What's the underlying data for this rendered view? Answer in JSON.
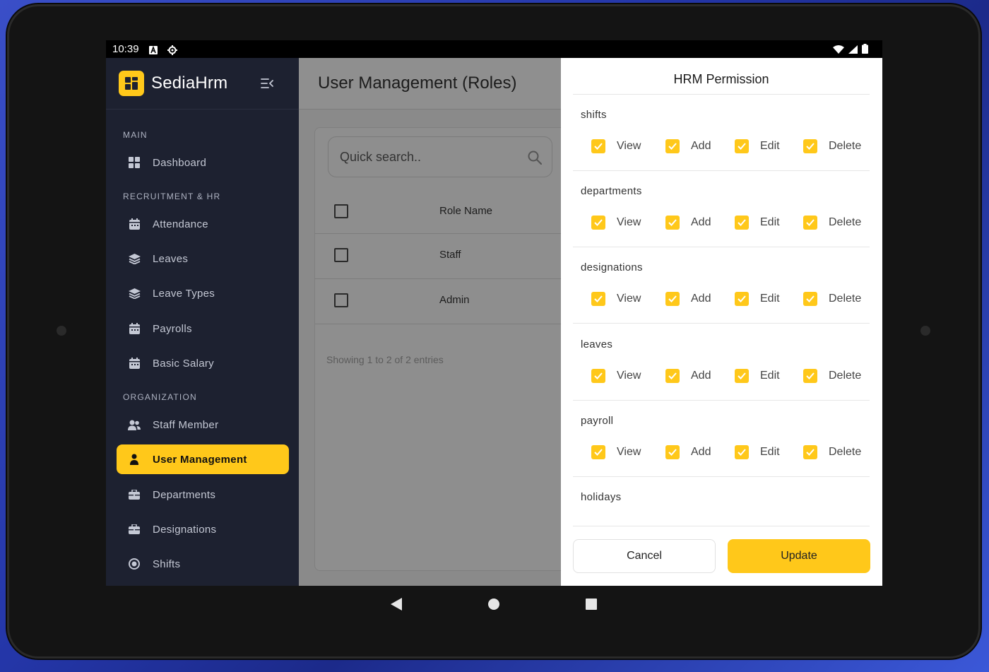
{
  "status_bar": {
    "time": "10:39"
  },
  "sidebar": {
    "brand": "SediaHrm",
    "sections": {
      "main": "MAIN",
      "recruitment": "RECRUITMENT & HR",
      "organization": "ORGANIZATION"
    },
    "items": {
      "dashboard": {
        "label": "Dashboard",
        "icon": "dashboard-icon"
      },
      "attendance": {
        "label": "Attendance",
        "icon": "calendar-icon"
      },
      "leaves": {
        "label": "Leaves",
        "icon": "layers-icon"
      },
      "leave_types": {
        "label": "Leave Types",
        "icon": "layers-icon"
      },
      "payrolls": {
        "label": "Payrolls",
        "icon": "calendar-icon"
      },
      "basic_salary": {
        "label": "Basic Salary",
        "icon": "calendar-icon"
      },
      "staff_member": {
        "label": "Staff Member",
        "icon": "users-icon"
      },
      "user_management": {
        "label": "User Management",
        "icon": "user-icon",
        "active": true
      },
      "departments": {
        "label": "Departments",
        "icon": "briefcase-icon"
      },
      "designations": {
        "label": "Designations",
        "icon": "briefcase-icon"
      },
      "shifts": {
        "label": "Shifts",
        "icon": "clock-icon"
      }
    }
  },
  "main": {
    "title": "User Management (Roles)",
    "search_placeholder": "Quick search..",
    "table": {
      "header": "Role Name",
      "rows": [
        "Staff",
        "Admin"
      ]
    },
    "entries_text": "Showing 1 to 2 of 2 entries"
  },
  "panel": {
    "title": "HRM Permission",
    "options": [
      "View",
      "Add",
      "Edit",
      "Delete"
    ],
    "groups": [
      "shifts",
      "departments",
      "designations",
      "leaves",
      "payroll",
      "holidays"
    ],
    "cancel_label": "Cancel",
    "update_label": "Update"
  },
  "colors": {
    "accent": "#ffc81a",
    "sidebar_bg": "#1d2130",
    "overlay_bg": "#8a8a8a"
  }
}
